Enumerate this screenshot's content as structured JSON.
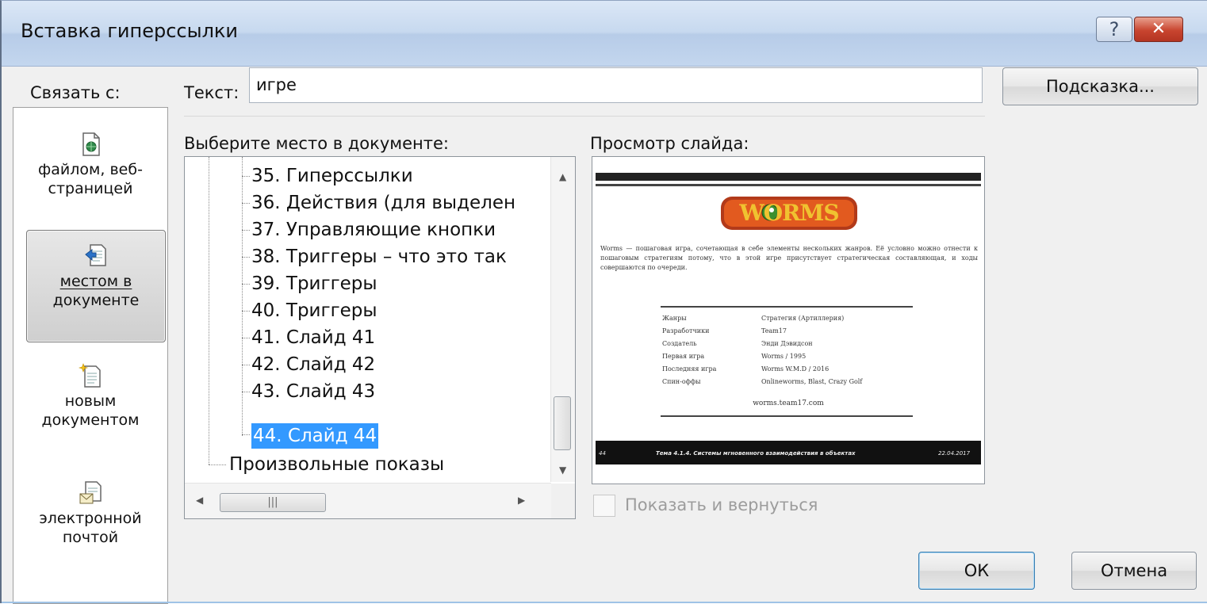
{
  "window": {
    "title": "Вставка гиперссылки",
    "help_label": "?",
    "close_label": "✕"
  },
  "link_to": {
    "label": "Связать с:",
    "items": [
      {
        "line1": "файлом, веб-",
        "line2": "страницей",
        "icon": "web-page-icon"
      },
      {
        "line1": "местом в",
        "line2": "документе",
        "icon": "document-place-icon",
        "selected": true
      },
      {
        "line1": "новым",
        "line2": "документом",
        "icon": "new-document-icon"
      },
      {
        "line1": "электронной",
        "line2": "почтой",
        "icon": "email-icon"
      }
    ]
  },
  "text_field": {
    "label": "Текст:",
    "value": "игре"
  },
  "hint_button": {
    "label": "Подсказка..."
  },
  "tree": {
    "label": "Выберите место в документе:",
    "items": [
      {
        "label": "35. Гиперссылки"
      },
      {
        "label": "36. Действия (для выделен"
      },
      {
        "label": "37. Управляющие кнопки"
      },
      {
        "label": "38. Триггеры – что это так"
      },
      {
        "label": "39. Триггеры"
      },
      {
        "label": "40. Триггеры"
      },
      {
        "label": "41. Слайд 41"
      },
      {
        "label": "42. Слайд 42"
      },
      {
        "label": "43. Слайд 43"
      },
      {
        "label": "44. Слайд 44",
        "selected": true
      }
    ],
    "custom_shows": "Произвольные показы"
  },
  "preview": {
    "label": "Просмотр слайда:",
    "slide": {
      "logo_text": "WORMS",
      "paragraph": "Worms — пошаговая игра, сочетающая в себе элементы нескольких жанров. Её условно можно отнести к пошаговым стратегиям потому, что в этой игре присутствует стратегическая составляющая, и ходы совершаются по очереди.",
      "rows": [
        {
          "k": "Жанры",
          "v": "Стратегия (Артиллерия)"
        },
        {
          "k": "Разработчики",
          "v": "Team17"
        },
        {
          "k": "Создатель",
          "v": "Энди Дэвидсон"
        },
        {
          "k": "Первая игра",
          "v": "Worms / 1995"
        },
        {
          "k": "Последняя игра",
          "v": "Worms W.M.D / 2016"
        },
        {
          "k": "Спин-оффы",
          "v": "Onlineworms, Blast, Crazy Golf"
        }
      ],
      "site": "worms.team17.com",
      "footer_num": "44",
      "footer_text": "Тема 4.1.4. Системы мгновенного взаимодействия в объектах",
      "footer_date": "22.04.2017"
    }
  },
  "show_and_return": {
    "label": "Показать и вернуться",
    "checked": false,
    "enabled": false
  },
  "buttons": {
    "ok": "ОК",
    "cancel": "Отмена"
  },
  "colors": {
    "selection": "#3399ff",
    "title_bar": "#c7d9ef",
    "close": "#c8452f"
  }
}
